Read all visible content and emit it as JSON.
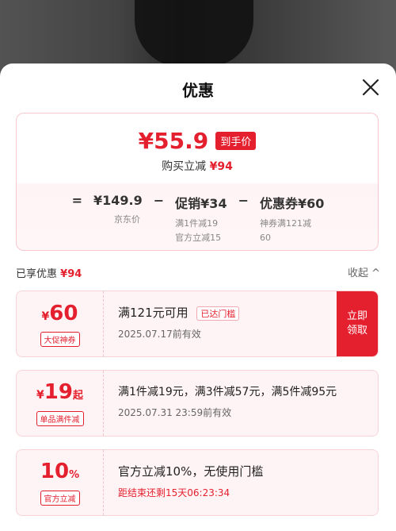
{
  "sheet": {
    "title": "优惠"
  },
  "summary": {
    "price": "¥55.9",
    "price_tag": "到手价",
    "buy_label": "购买立减",
    "buy_amount": "¥94",
    "calc": {
      "eq": "=",
      "minus": "−",
      "base": {
        "value": "¥149.9",
        "label": "京东价"
      },
      "promo": {
        "value": "促销¥34",
        "lines": [
          "满1件减19",
          "官方立减15"
        ]
      },
      "coupon": {
        "value": "优惠券¥60",
        "lines": [
          "神券满121减",
          "60"
        ]
      }
    }
  },
  "enjoyed": {
    "label": "已享优惠",
    "amount": "¥94",
    "collapse": "收起 ^"
  },
  "coupons": [
    {
      "cur": "¥",
      "amount": "60",
      "suffix": "",
      "tag": "大促神券",
      "title": "满121元可用",
      "threshold": "已达门槛",
      "sub": "2025.07.17前有效",
      "button": "立即 领取"
    },
    {
      "cur": "¥",
      "amount": "19",
      "suffix": "起",
      "tag": "单品满件减",
      "title": "满1件减19元，满3件减57元，满5件减95元",
      "sub": "2025.07.31 23:59前有效"
    },
    {
      "cur": "",
      "amount": "10",
      "suffix": "%",
      "tag": "官方立减",
      "title": "官方立减10%，无使用门槛",
      "sub": "距结束还剩15天06:23:34"
    }
  ],
  "colors": {
    "accent": "#e4202f",
    "card_bg": "#fff4f5"
  }
}
